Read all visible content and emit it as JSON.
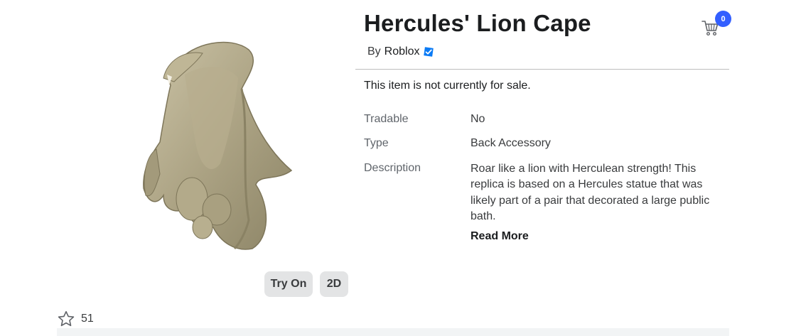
{
  "item": {
    "title": "Hercules' Lion Cape",
    "by_label": "By",
    "creator": "Roblox",
    "sale_status": "This item is not currently for sale."
  },
  "details": [
    {
      "label": "Tradable",
      "value": "No"
    },
    {
      "label": "Type",
      "value": "Back Accessory"
    },
    {
      "label": "Description",
      "value": "Roar like a lion with Herculean strength! This replica is based on a Hercules statue that was likely part of a pair that decorated a large public bath."
    }
  ],
  "read_more_label": "Read More",
  "preview_buttons": {
    "try_on": "Try On",
    "two_d": "2D"
  },
  "favorites": {
    "count": "51",
    "icon": "star-outline-icon"
  },
  "cart": {
    "count": "0",
    "icon": "cart-icon"
  },
  "colors": {
    "accent": "#335fff",
    "verified": "#0b7bf5"
  }
}
